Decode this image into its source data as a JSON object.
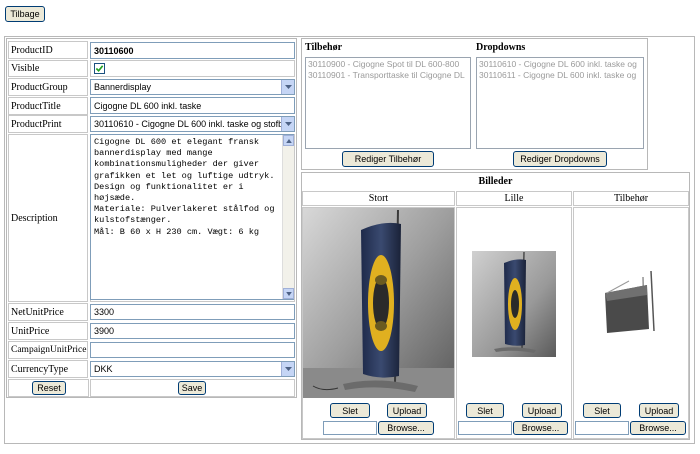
{
  "toolbar": {
    "back_label": "Tilbage"
  },
  "form": {
    "rows": [
      {
        "label": "ProductID",
        "value": "30110600"
      },
      {
        "label": "Visible",
        "checked": true
      },
      {
        "label": "ProductGroup",
        "value": "Bannerdisplay"
      },
      {
        "label": "ProductTitle",
        "value": "Cigogne DL 600 inkl. taske"
      },
      {
        "label": "ProductPrint",
        "value": "30110610 - Cigogne DL 600 inkl. taske og stofb"
      },
      {
        "label": "Description",
        "value": "Cigogne DL 600 et elegant fransk bannerdisplay med mange kombinationsmuligheder der giver grafikken et let og luftige udtryk. Design og funktionalitet er i højsæde.\nMateriale: Pulverlakeret stålfod og kulstofstænger.\nMål: B 60 x H 230 cm. Vægt: 6 kg"
      },
      {
        "label": "NetUnitPrice",
        "value": "3300"
      },
      {
        "label": "UnitPrice",
        "value": "3900"
      },
      {
        "label": "CampaignUnitPrice",
        "value": ""
      },
      {
        "label": "CurrencyType",
        "value": "DKK"
      }
    ],
    "reset_label": "Reset",
    "save_label": "Save"
  },
  "tilbehor": {
    "header": "Tilbehør",
    "items": [
      "30110900 - Cigogne Spot til DL 600-800",
      "30110901 - Transporttaske til Cigogne DL"
    ],
    "edit_label": "Rediger Tilbehør"
  },
  "dropdowns": {
    "header": "Dropdowns",
    "items": [
      "30110610 - Cigogne DL 600 inkl. taske og",
      "30110611 - Cigogne DL 600 inkl. taske og"
    ],
    "edit_label": "Rediger Dropdowns"
  },
  "billeder": {
    "header": "Billeder",
    "columns": [
      {
        "title": "Stort",
        "delete_label": "Slet",
        "upload_label": "Upload",
        "browse_label": "Browse..."
      },
      {
        "title": "Lille",
        "delete_label": "Slet",
        "upload_label": "Upload",
        "browse_label": "Browse..."
      },
      {
        "title": "Tilbehør",
        "delete_label": "Slet",
        "upload_label": "Upload",
        "browse_label": "Browse..."
      }
    ]
  },
  "colors": {
    "button_bg": "#ece9d8",
    "button_border": "#003c74",
    "dropdown_arrow": "#c5d5f5",
    "car_yellow": "#e8b923"
  }
}
